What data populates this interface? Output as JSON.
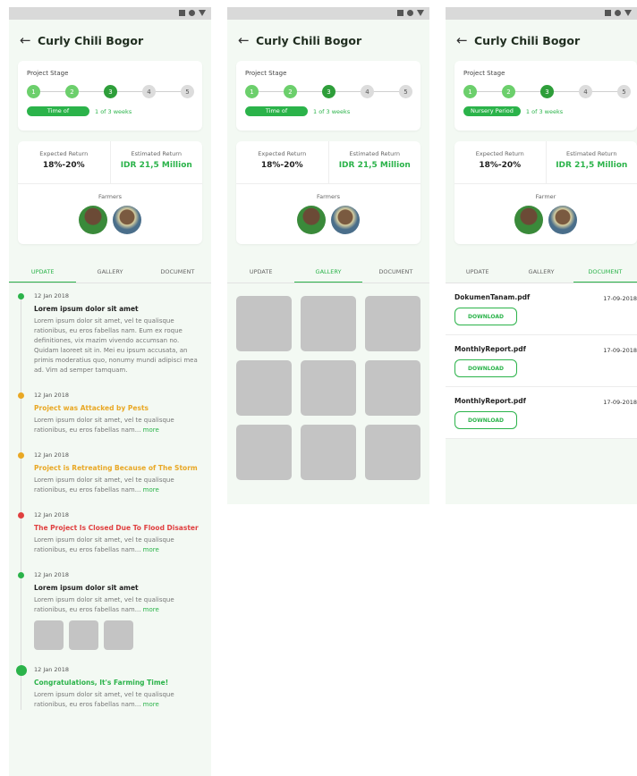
{
  "colors": {
    "accent": "#2bb34a",
    "orange": "#e9a825",
    "red": "#e04040",
    "dark_green": "#2e9e3a"
  },
  "project_title": "Curly Chili Bogor",
  "stage": {
    "label": "Project Stage",
    "steps": [
      "1",
      "2",
      "3",
      "4",
      "5"
    ],
    "current_step": 3,
    "pill_time_of": "Time of",
    "pill_nursery": "Nursery Period",
    "period_text": "1 of 3 weeks"
  },
  "returns": {
    "expected_label": "Expected  Return",
    "expected_value": "18%-20%",
    "estimated_label": "Estimated Return",
    "estimated_value": "IDR 21,5 Million",
    "farmers_label": "Farmers",
    "farmer_label_single": "Farmer"
  },
  "tabs": [
    "UPDATE",
    "GALLERY",
    "DOCUMENT"
  ],
  "updates": [
    {
      "date": "12 Jan 2018",
      "title": "Lorem ipsum dolor sit amet",
      "color": "#2bb34a",
      "text_color": "#222",
      "body": "Lorem ipsum dolor sit amet, vel te qualisque rationibus, eu eros fabellas nam. Eum ex roque definitiones, vix mazim vivendo accumsan no. Quidam laoreet sit in. Mei eu ipsum accusata, an primis moderatius quo, nonumy mundi adipisci mea ad. Vim ad semper tamquam.",
      "more": ""
    },
    {
      "date": "12 Jan 2018",
      "title": "Project was Attacked by Pests",
      "color": "#e9a825",
      "text_color": "#e9a825",
      "body": "Lorem ipsum dolor sit amet, vel te qualisque rationibus, eu eros fabellas nam...",
      "more": "more"
    },
    {
      "date": "12 Jan 2018",
      "title": "Project is Retreating Because of The Storm",
      "color": "#e9a825",
      "text_color": "#e9a825",
      "body": "Lorem ipsum dolor sit amet, vel te qualisque rationibus, eu eros fabellas nam...",
      "more": "more"
    },
    {
      "date": "12 Jan 2018",
      "title": "The Project Is Closed Due To Flood Disaster",
      "color": "#e04040",
      "text_color": "#e04040",
      "body": "Lorem ipsum dolor sit amet, vel te qualisque rationibus, eu eros fabellas nam...",
      "more": "more"
    },
    {
      "date": "12 Jan 2018",
      "title": "Lorem ipsum dolor sit amet",
      "color": "#2bb34a",
      "text_color": "#222",
      "body": "Lorem ipsum dolor sit amet, vel te qualisque rationibus, eu eros fabellas nam...",
      "more": "more"
    },
    {
      "date": "12 Jan 2018",
      "title": "Congratulations, It's Farming Time!",
      "color": "#2bb34a",
      "text_color": "#2bb34a",
      "body": "Lorem ipsum dolor sit amet, vel te qualisque rationibus, eu eros fabellas nam...",
      "more": "more"
    }
  ],
  "documents": [
    {
      "name": "DokumenTanam.pdf",
      "date": "17-09-2018",
      "button": "DOWNLOAD"
    },
    {
      "name": "MonthlyReport.pdf",
      "date": "17-09-2018",
      "button": "DOWNLOAD"
    },
    {
      "name": "MonthlyReport.pdf",
      "date": "17-09-2018",
      "button": "DOWNLOAD"
    }
  ],
  "icons": {
    "back": "arrow-left-icon"
  }
}
